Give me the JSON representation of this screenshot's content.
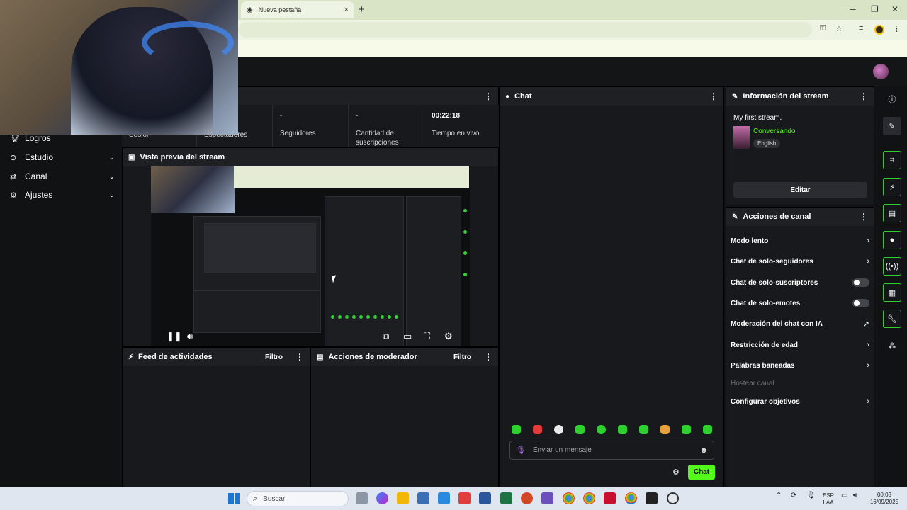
{
  "browser": {
    "tab_title": "Nueva pestaña",
    "tab_close": "×",
    "new_tab": "+"
  },
  "sidebar": {
    "items": [
      {
        "label": "Logros",
        "icon": "trophy-icon",
        "has_chevron": false
      },
      {
        "label": "Estudio",
        "icon": "studio-icon",
        "has_chevron": true
      },
      {
        "label": "Canal",
        "icon": "channel-icon",
        "has_chevron": true
      },
      {
        "label": "Ajustes",
        "icon": "gear-icon",
        "has_chevron": true
      }
    ]
  },
  "stats": [
    {
      "value": "",
      "label": "Sesión"
    },
    {
      "value": "",
      "label": "Espectadores"
    },
    {
      "value": "-",
      "label": "Seguidores"
    },
    {
      "value": "-",
      "label": "Cantidad de suscripciones"
    },
    {
      "value": "00:22:18",
      "label": "Tiempo en vivo"
    }
  ],
  "panels": {
    "preview_title": "Vista previa del stream",
    "activity_title": "Feed de actividades",
    "activity_filter": "Filtro",
    "moderator_title": "Acciones de moderador",
    "moderator_filter": "Filtro",
    "chat_title": "Chat",
    "stream_info_title": "Información del stream",
    "channel_actions_title": "Acciones de canal",
    "menu": "⋮"
  },
  "chat": {
    "placeholder": "Enviar un mensaje",
    "send_label": "Chat"
  },
  "stream_info": {
    "title": "My first stream.",
    "category": "Conversando",
    "language": "English",
    "edit_label": "Editar"
  },
  "channel_actions": [
    {
      "label": "Modo lento",
      "control": "chevron"
    },
    {
      "label": "Chat de solo-seguidores",
      "control": "chevron"
    },
    {
      "label": "Chat de solo-suscriptores",
      "control": "toggle",
      "on": false
    },
    {
      "label": "Chat de solo-emotes",
      "control": "toggle",
      "on": false
    },
    {
      "label": "Moderación del chat con IA",
      "control": "external"
    },
    {
      "label": "Restricción de edad",
      "control": "chevron"
    },
    {
      "label": "Palabras baneadas",
      "control": "chevron"
    },
    {
      "label": "Hostear canal",
      "control": "none",
      "disabled": true
    },
    {
      "label": "Configurar objetivos",
      "control": "chevron"
    }
  ],
  "taskbar": {
    "search_placeholder": "Buscar",
    "lang_1": "ESP",
    "lang_2": "LAA",
    "time": "00:03",
    "date": "16/09/2025"
  },
  "colors": {
    "accent": "#53fc18",
    "panel_bg": "#18191c",
    "header_bg": "#1f2024"
  }
}
